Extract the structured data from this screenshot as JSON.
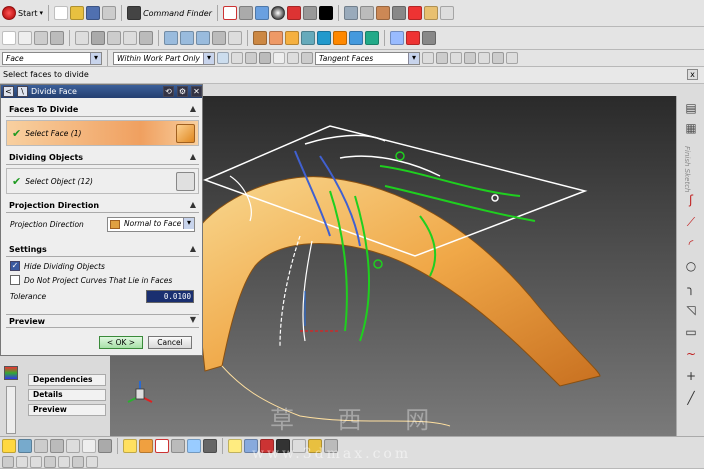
{
  "toolbar1": {
    "start_label": "Start",
    "command_finder_label": "Command Finder"
  },
  "selection_bar": {
    "filter_value": "Face",
    "scope_value": "Within Work Part Only",
    "face_rule_value": "Tangent Faces"
  },
  "cue_line": "Select faces to divide",
  "dialog": {
    "title": "Divide Face",
    "faces_group": {
      "heading": "Faces To Divide",
      "select_label": "Select Face (1)"
    },
    "dividing_group": {
      "heading": "Dividing Objects",
      "select_label": "Select Object (12)"
    },
    "projection_group": {
      "heading": "Projection Direction",
      "label": "Projection Direction",
      "value": "Normal to Face"
    },
    "settings_group": {
      "heading": "Settings",
      "hide_dividing_label": "Hide Dividing Objects",
      "hide_dividing_checked": true,
      "no_project_label": "Do Not Project Curves That Lie in Faces",
      "no_project_checked": false,
      "tolerance_label": "Tolerance",
      "tolerance_value": "0.0100"
    },
    "preview_group": {
      "heading": "Preview"
    },
    "ok_label": "< OK >",
    "cancel_label": "Cancel"
  },
  "navigator": {
    "items": [
      "Dependencies",
      "Details",
      "Preview"
    ]
  },
  "rightbar": {
    "vertical_label": "Finish Sketch"
  },
  "watermark": {
    "chars": "草 西 网",
    "url": "www.3dmax.com"
  },
  "colors": {
    "title_blue": "#2b4b85",
    "face_orange": "#f0a040",
    "curve_green": "#1fcf1f",
    "curve_blue": "#4060d0",
    "check_green": "#1e9a20"
  }
}
